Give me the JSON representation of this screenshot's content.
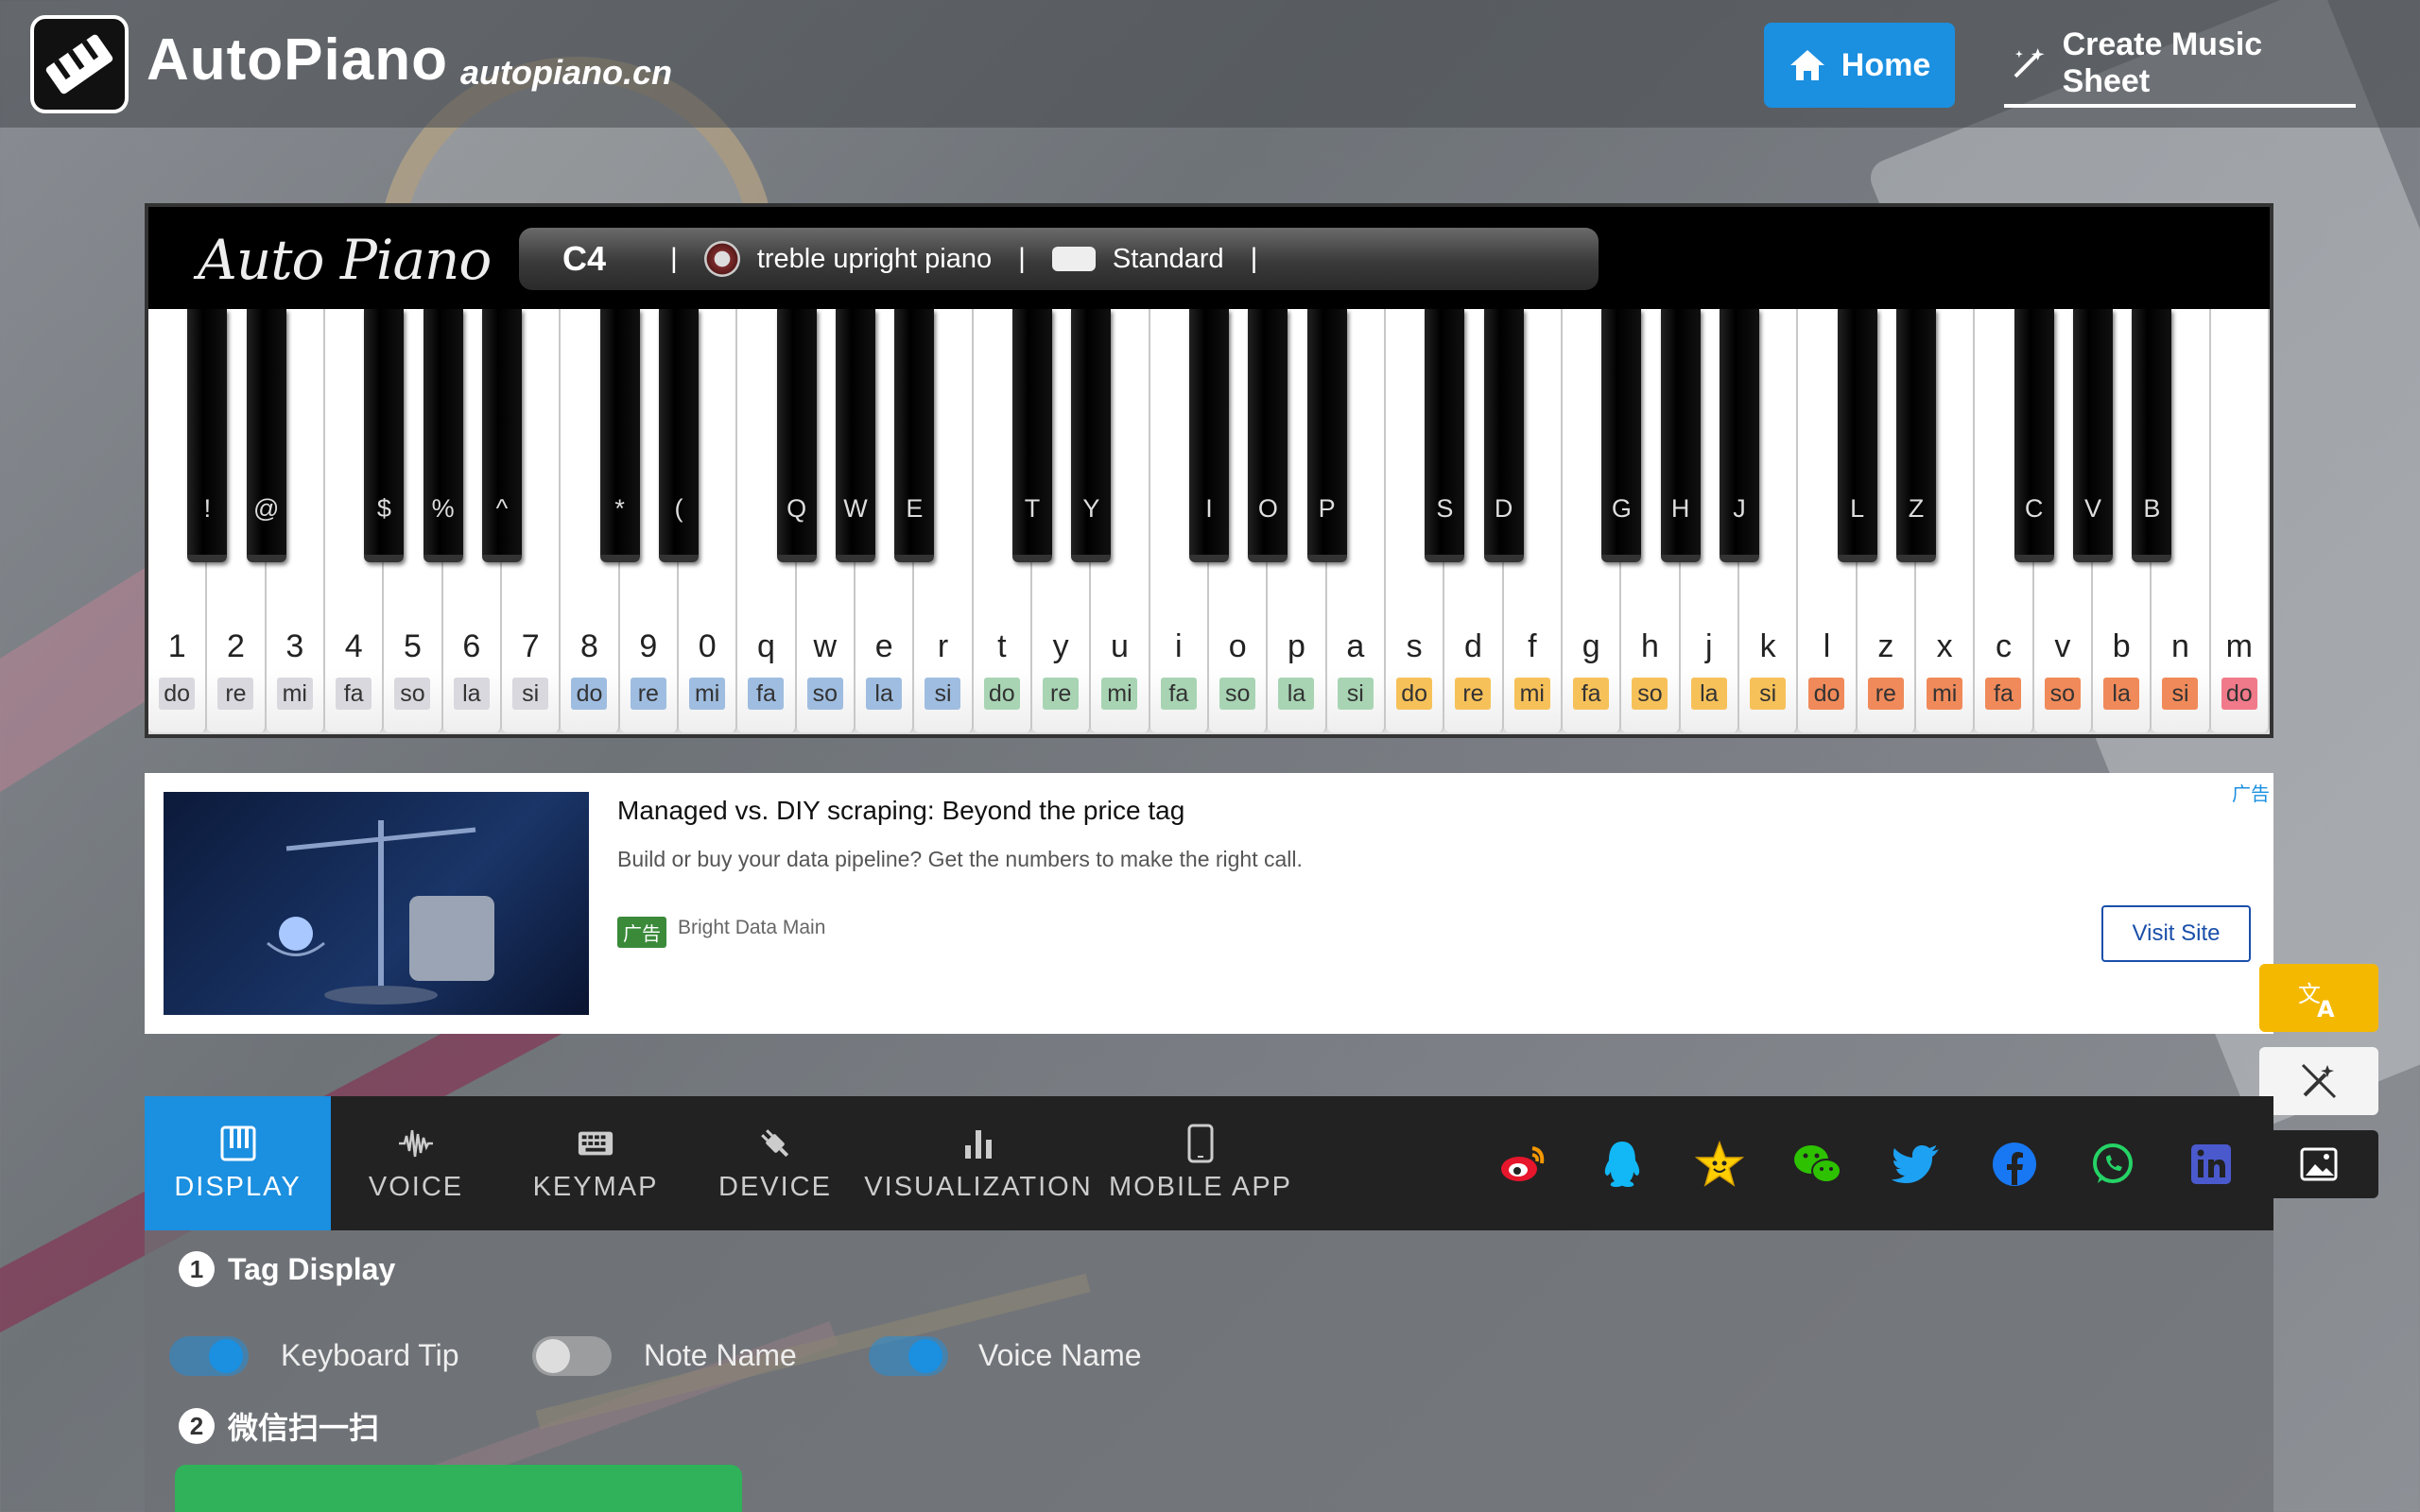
{
  "header": {
    "brand": "AutoPiano",
    "domain": "autopiano.cn",
    "home_label": "Home",
    "create_label": "Create Music Sheet"
  },
  "piano": {
    "logo_text": "Auto Piano",
    "current_note": "C4",
    "instrument": "treble upright piano",
    "mode": "Standard",
    "separator": "|",
    "white_keys": [
      {
        "key": "1",
        "solfege": "do"
      },
      {
        "key": "2",
        "solfege": "re"
      },
      {
        "key": "3",
        "solfege": "mi"
      },
      {
        "key": "4",
        "solfege": "fa"
      },
      {
        "key": "5",
        "solfege": "so"
      },
      {
        "key": "6",
        "solfege": "la"
      },
      {
        "key": "7",
        "solfege": "si"
      },
      {
        "key": "8",
        "solfege": "do"
      },
      {
        "key": "9",
        "solfege": "re"
      },
      {
        "key": "0",
        "solfege": "mi"
      },
      {
        "key": "q",
        "solfege": "fa"
      },
      {
        "key": "w",
        "solfege": "so"
      },
      {
        "key": "e",
        "solfege": "la"
      },
      {
        "key": "r",
        "solfege": "si"
      },
      {
        "key": "t",
        "solfege": "do"
      },
      {
        "key": "y",
        "solfege": "re"
      },
      {
        "key": "u",
        "solfege": "mi"
      },
      {
        "key": "i",
        "solfege": "fa"
      },
      {
        "key": "o",
        "solfege": "so"
      },
      {
        "key": "p",
        "solfege": "la"
      },
      {
        "key": "a",
        "solfege": "si"
      },
      {
        "key": "s",
        "solfege": "do"
      },
      {
        "key": "d",
        "solfege": "re"
      },
      {
        "key": "f",
        "solfege": "mi"
      },
      {
        "key": "g",
        "solfege": "fa"
      },
      {
        "key": "h",
        "solfege": "so"
      },
      {
        "key": "j",
        "solfege": "la"
      },
      {
        "key": "k",
        "solfege": "si"
      },
      {
        "key": "l",
        "solfege": "do"
      },
      {
        "key": "z",
        "solfege": "re"
      },
      {
        "key": "x",
        "solfege": "mi"
      },
      {
        "key": "c",
        "solfege": "fa"
      },
      {
        "key": "v",
        "solfege": "so"
      },
      {
        "key": "b",
        "solfege": "la"
      },
      {
        "key": "n",
        "solfege": "si"
      },
      {
        "key": "m",
        "solfege": "do"
      }
    ],
    "black_keys": [
      "!",
      "@",
      "$",
      "%",
      "^",
      "*",
      "(",
      "Q",
      "W",
      "E",
      "T",
      "Y",
      "I",
      "O",
      "P",
      "S",
      "D",
      "G",
      "H",
      "J",
      "L",
      "Z",
      "C",
      "V",
      "B"
    ],
    "octave_colors": [
      "#d8d8de",
      "#9fbde0",
      "#a8d4b4",
      "#f7c15a",
      "#f08a5a",
      "#f07a8a"
    ]
  },
  "ad": {
    "title": "Managed vs. DIY scraping: Beyond the price tag",
    "description": "Build or buy your data pipeline? Get the numbers to make the right call.",
    "tag": "广告",
    "source": "Bright Data Main",
    "corner": "广告",
    "cta": "Visit Site"
  },
  "tabs": [
    {
      "label": "DISPLAY",
      "icon": "piano-keys-icon"
    },
    {
      "label": "VOICE",
      "icon": "waveform-icon"
    },
    {
      "label": "KEYMAP",
      "icon": "keyboard-icon"
    },
    {
      "label": "DEVICE",
      "icon": "plug-icon"
    },
    {
      "label": "VISUALIZATION",
      "icon": "bar-chart-icon"
    },
    {
      "label": "MOBILE APP",
      "icon": "phone-icon"
    }
  ],
  "social": [
    "weibo-icon",
    "qq-icon",
    "qzone-star-icon",
    "wechat-icon",
    "twitter-icon",
    "facebook-icon",
    "whatsapp-icon",
    "linkedin-icon"
  ],
  "panel": {
    "section1_num": "1",
    "section1_title": "Tag Display",
    "toggles": [
      {
        "label": "Keyboard Tip",
        "on": true
      },
      {
        "label": "Note Name",
        "on": false
      },
      {
        "label": "Voice Name",
        "on": true
      }
    ],
    "section2_num": "2",
    "section2_title": "微信扫一扫"
  },
  "colors": {
    "accent": "#1b8fe0",
    "translate": "#f5b800"
  }
}
